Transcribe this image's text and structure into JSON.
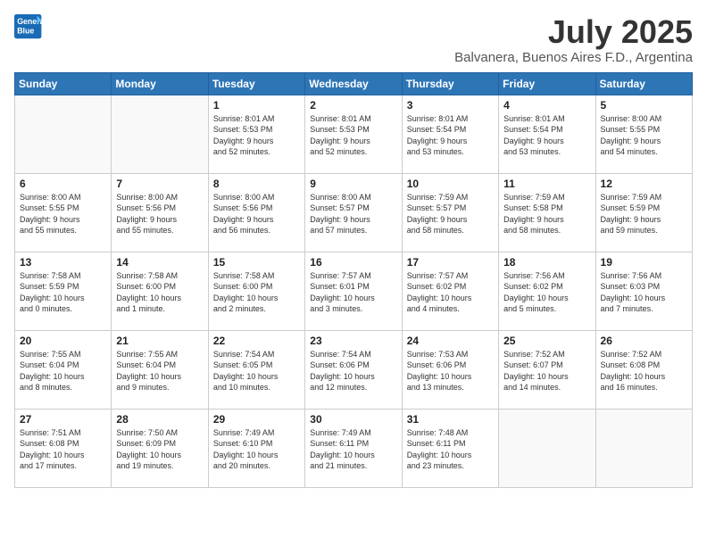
{
  "header": {
    "logo_line1": "General",
    "logo_line2": "Blue",
    "month_year": "July 2025",
    "location": "Balvanera, Buenos Aires F.D., Argentina"
  },
  "weekdays": [
    "Sunday",
    "Monday",
    "Tuesday",
    "Wednesday",
    "Thursday",
    "Friday",
    "Saturday"
  ],
  "weeks": [
    [
      {
        "day": "",
        "info": ""
      },
      {
        "day": "",
        "info": ""
      },
      {
        "day": "1",
        "info": "Sunrise: 8:01 AM\nSunset: 5:53 PM\nDaylight: 9 hours\nand 52 minutes."
      },
      {
        "day": "2",
        "info": "Sunrise: 8:01 AM\nSunset: 5:53 PM\nDaylight: 9 hours\nand 52 minutes."
      },
      {
        "day": "3",
        "info": "Sunrise: 8:01 AM\nSunset: 5:54 PM\nDaylight: 9 hours\nand 53 minutes."
      },
      {
        "day": "4",
        "info": "Sunrise: 8:01 AM\nSunset: 5:54 PM\nDaylight: 9 hours\nand 53 minutes."
      },
      {
        "day": "5",
        "info": "Sunrise: 8:00 AM\nSunset: 5:55 PM\nDaylight: 9 hours\nand 54 minutes."
      }
    ],
    [
      {
        "day": "6",
        "info": "Sunrise: 8:00 AM\nSunset: 5:55 PM\nDaylight: 9 hours\nand 55 minutes."
      },
      {
        "day": "7",
        "info": "Sunrise: 8:00 AM\nSunset: 5:56 PM\nDaylight: 9 hours\nand 55 minutes."
      },
      {
        "day": "8",
        "info": "Sunrise: 8:00 AM\nSunset: 5:56 PM\nDaylight: 9 hours\nand 56 minutes."
      },
      {
        "day": "9",
        "info": "Sunrise: 8:00 AM\nSunset: 5:57 PM\nDaylight: 9 hours\nand 57 minutes."
      },
      {
        "day": "10",
        "info": "Sunrise: 7:59 AM\nSunset: 5:57 PM\nDaylight: 9 hours\nand 58 minutes."
      },
      {
        "day": "11",
        "info": "Sunrise: 7:59 AM\nSunset: 5:58 PM\nDaylight: 9 hours\nand 58 minutes."
      },
      {
        "day": "12",
        "info": "Sunrise: 7:59 AM\nSunset: 5:59 PM\nDaylight: 9 hours\nand 59 minutes."
      }
    ],
    [
      {
        "day": "13",
        "info": "Sunrise: 7:58 AM\nSunset: 5:59 PM\nDaylight: 10 hours\nand 0 minutes."
      },
      {
        "day": "14",
        "info": "Sunrise: 7:58 AM\nSunset: 6:00 PM\nDaylight: 10 hours\nand 1 minute."
      },
      {
        "day": "15",
        "info": "Sunrise: 7:58 AM\nSunset: 6:00 PM\nDaylight: 10 hours\nand 2 minutes."
      },
      {
        "day": "16",
        "info": "Sunrise: 7:57 AM\nSunset: 6:01 PM\nDaylight: 10 hours\nand 3 minutes."
      },
      {
        "day": "17",
        "info": "Sunrise: 7:57 AM\nSunset: 6:02 PM\nDaylight: 10 hours\nand 4 minutes."
      },
      {
        "day": "18",
        "info": "Sunrise: 7:56 AM\nSunset: 6:02 PM\nDaylight: 10 hours\nand 5 minutes."
      },
      {
        "day": "19",
        "info": "Sunrise: 7:56 AM\nSunset: 6:03 PM\nDaylight: 10 hours\nand 7 minutes."
      }
    ],
    [
      {
        "day": "20",
        "info": "Sunrise: 7:55 AM\nSunset: 6:04 PM\nDaylight: 10 hours\nand 8 minutes."
      },
      {
        "day": "21",
        "info": "Sunrise: 7:55 AM\nSunset: 6:04 PM\nDaylight: 10 hours\nand 9 minutes."
      },
      {
        "day": "22",
        "info": "Sunrise: 7:54 AM\nSunset: 6:05 PM\nDaylight: 10 hours\nand 10 minutes."
      },
      {
        "day": "23",
        "info": "Sunrise: 7:54 AM\nSunset: 6:06 PM\nDaylight: 10 hours\nand 12 minutes."
      },
      {
        "day": "24",
        "info": "Sunrise: 7:53 AM\nSunset: 6:06 PM\nDaylight: 10 hours\nand 13 minutes."
      },
      {
        "day": "25",
        "info": "Sunrise: 7:52 AM\nSunset: 6:07 PM\nDaylight: 10 hours\nand 14 minutes."
      },
      {
        "day": "26",
        "info": "Sunrise: 7:52 AM\nSunset: 6:08 PM\nDaylight: 10 hours\nand 16 minutes."
      }
    ],
    [
      {
        "day": "27",
        "info": "Sunrise: 7:51 AM\nSunset: 6:08 PM\nDaylight: 10 hours\nand 17 minutes."
      },
      {
        "day": "28",
        "info": "Sunrise: 7:50 AM\nSunset: 6:09 PM\nDaylight: 10 hours\nand 19 minutes."
      },
      {
        "day": "29",
        "info": "Sunrise: 7:49 AM\nSunset: 6:10 PM\nDaylight: 10 hours\nand 20 minutes."
      },
      {
        "day": "30",
        "info": "Sunrise: 7:49 AM\nSunset: 6:11 PM\nDaylight: 10 hours\nand 21 minutes."
      },
      {
        "day": "31",
        "info": "Sunrise: 7:48 AM\nSunset: 6:11 PM\nDaylight: 10 hours\nand 23 minutes."
      },
      {
        "day": "",
        "info": ""
      },
      {
        "day": "",
        "info": ""
      }
    ]
  ]
}
